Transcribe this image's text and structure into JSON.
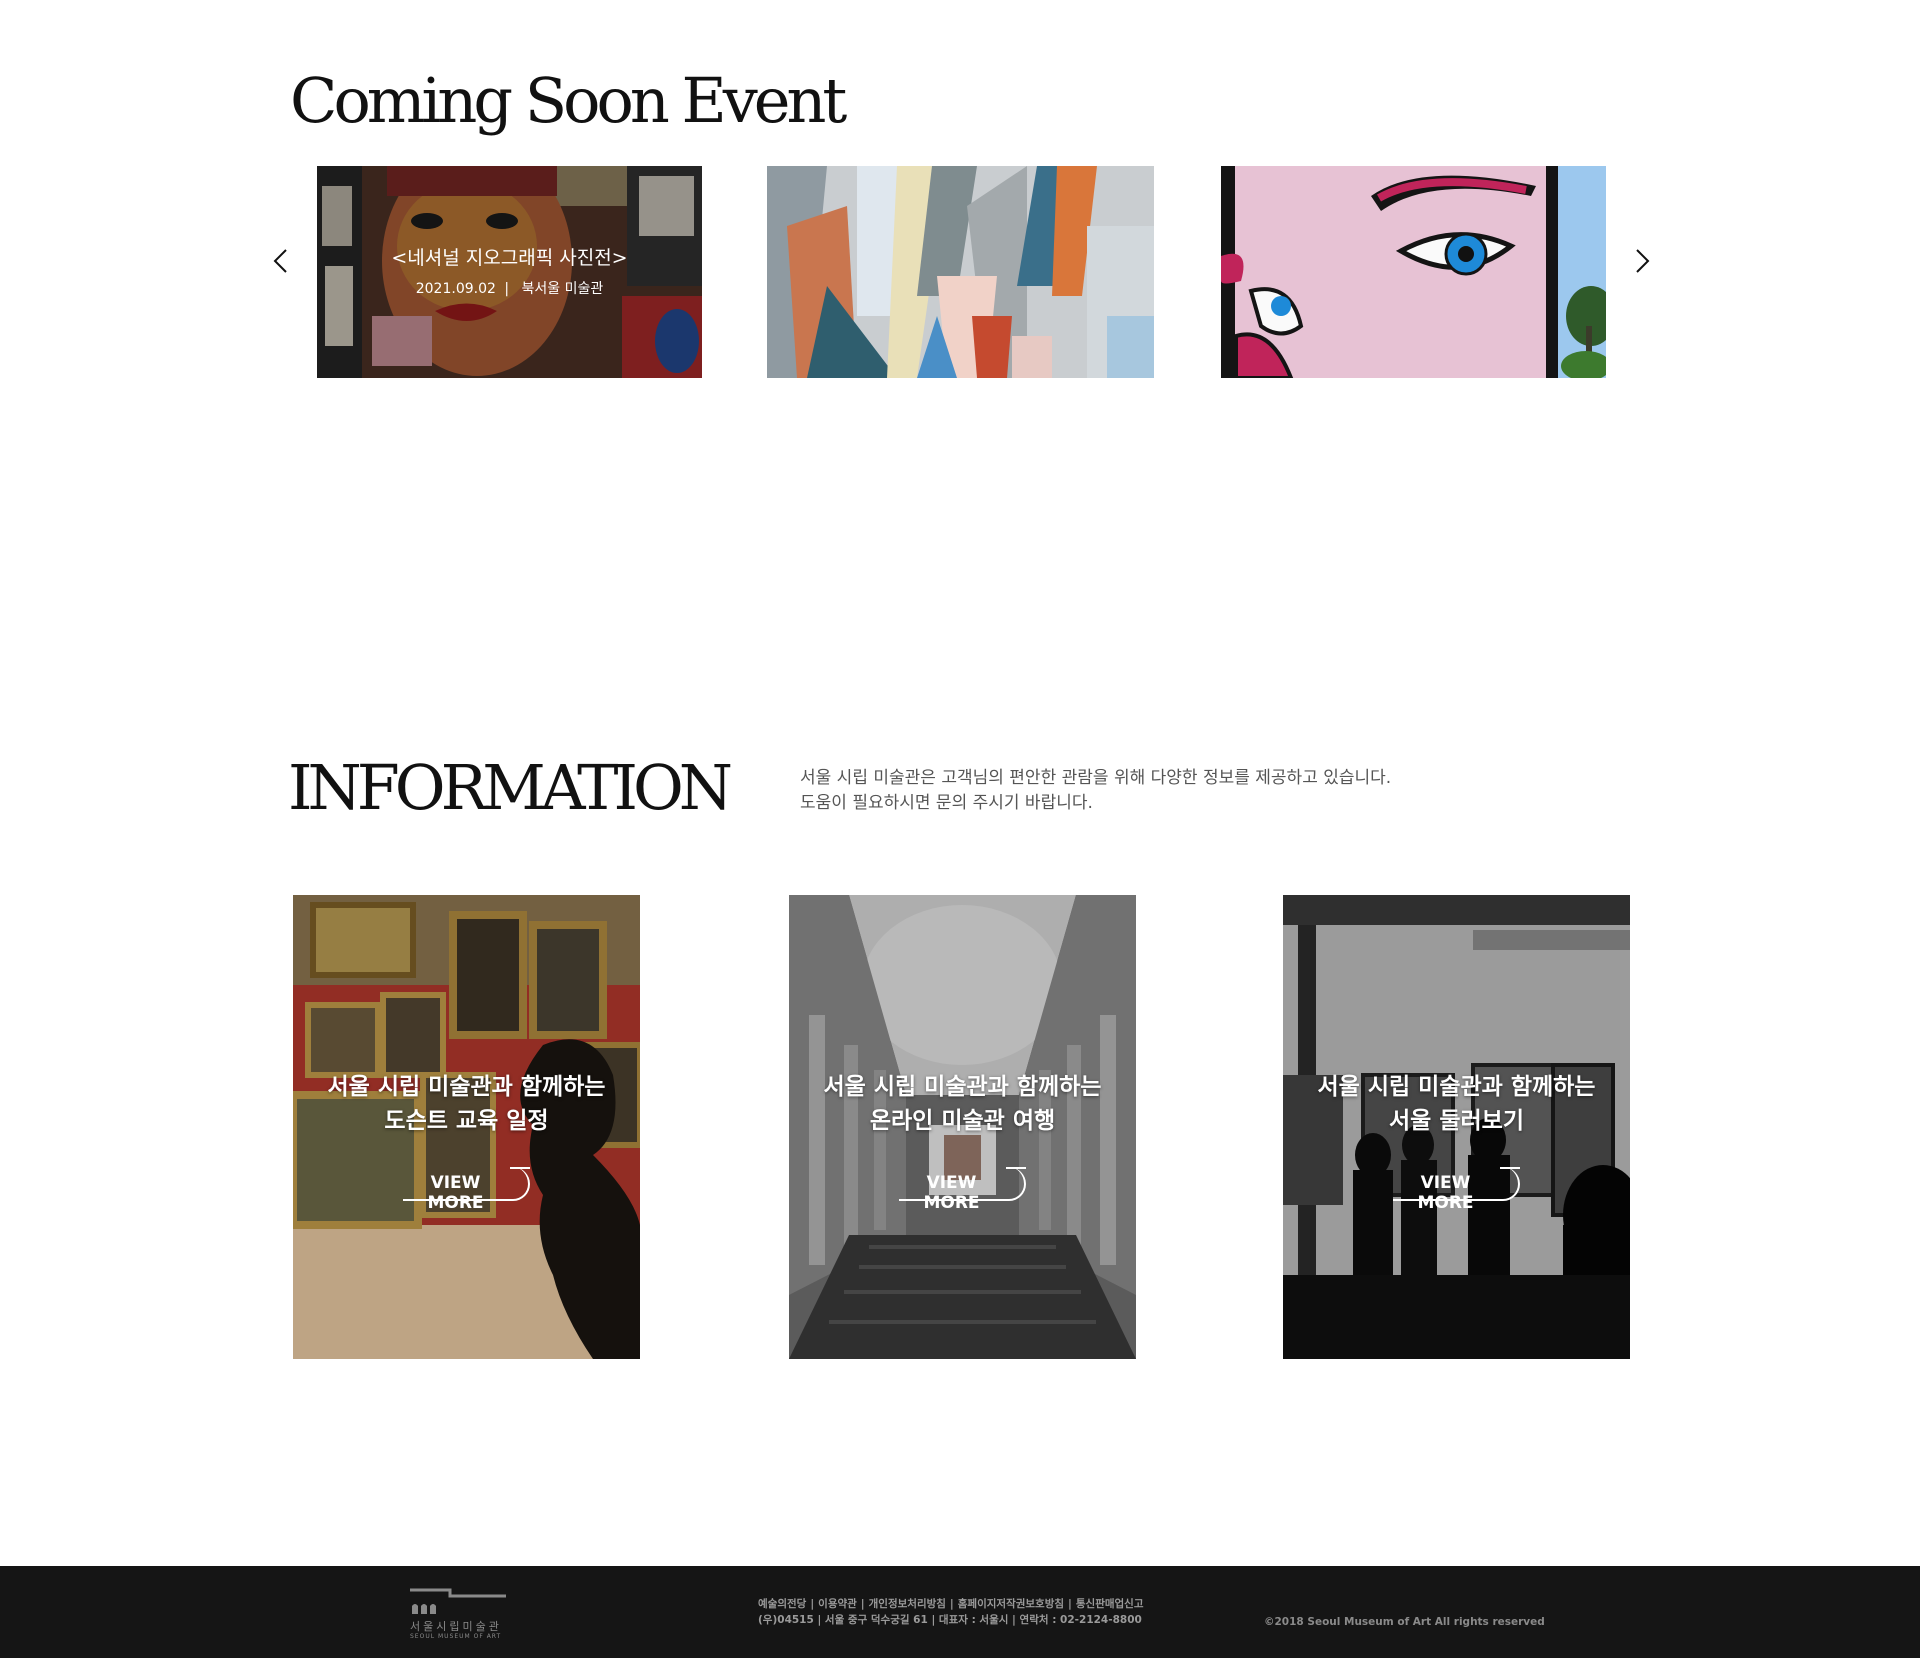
{
  "coming_soon": {
    "heading": "Coming Soon  Event",
    "events": [
      {
        "title": "<네셔널 지오그래픽 사진전>",
        "date": "2021.09.02",
        "separator": "|",
        "venue": "북서울 미술관"
      }
    ]
  },
  "information": {
    "heading": "INFORMATION",
    "description_line1": "서울 시립 미술관은 고객님의 편안한 관람을 위해 다양한 정보를 제공하고 있습니다.",
    "description_line2": "도움이 필요하시면 문의 주시기 바랍니다.",
    "cards": [
      {
        "line1": "서울 시립 미술관과 함께하는",
        "line2": "도슨트 교육 일정",
        "button": "VIEW MORE"
      },
      {
        "line1": "서울 시립 미술관과 함께하는",
        "line2": "온라인 미술관 여행",
        "button": "VIEW MORE"
      },
      {
        "line1": "서울 시립 미술관과 함께하는",
        "line2": "서울 둘러보기",
        "button": "VIEW MORE"
      }
    ]
  },
  "footer": {
    "logo_kr": "서울시립미술관",
    "logo_en": "SEOUL MUSEUM OF ART",
    "links": [
      "예술의전당",
      "이용약관",
      "개인정보처리방침",
      "홈페이지저작권보호방침",
      "통신판매업신고"
    ],
    "address": "(우)04515  | 서울 중구 덕수궁길 61 | 대표자 : 서울시 | 연락처 : 02-2124-8800",
    "copyright": "©2018 Seoul Museum of Art All rights reserved"
  },
  "icons": {
    "prev": "chevron-left-icon",
    "next": "chevron-right-icon",
    "logo": "museum-logo-icon"
  }
}
